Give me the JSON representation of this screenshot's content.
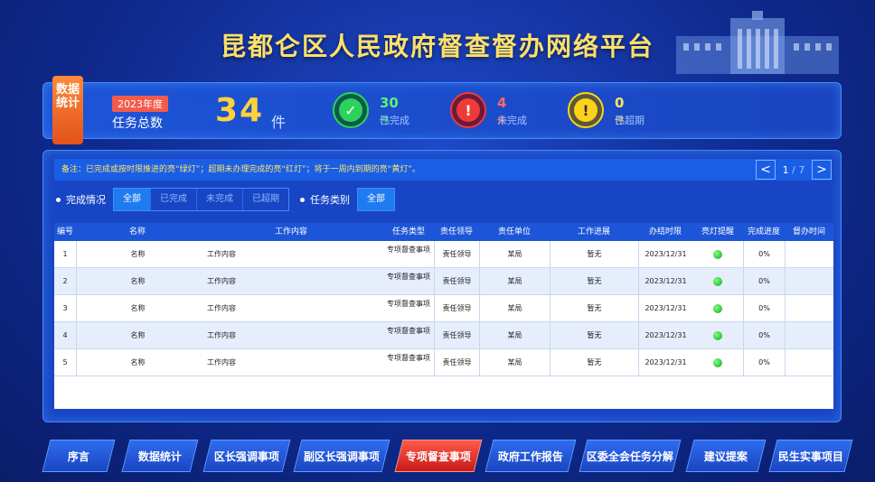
{
  "header": {
    "title": "昆都仑区人民政府督查督办网络平台"
  },
  "stats": {
    "tag": "数据统计",
    "year_badge": "2023年度",
    "total_label": "任务总数",
    "total_value": "34",
    "total_unit": "件",
    "items": [
      {
        "value": "30",
        "unit": "件",
        "label": "已完成",
        "icon": "check-icon",
        "color": "#2ad35a"
      },
      {
        "value": "4",
        "unit": "件",
        "label": "未完成",
        "icon": "exclamation-icon",
        "color": "#f03a3a"
      },
      {
        "value": "0",
        "unit": "件",
        "label": "已超期",
        "icon": "exclamation-icon",
        "color": "#ffd21a"
      }
    ]
  },
  "main": {
    "note": "备注：已完成或按时限推进的亮“绿灯”；超期未办理完成的亮“红灯”；将于一周内到期的亮“黄灯”。",
    "pager": {
      "prev": "<",
      "current": "1",
      "total": "/ 7",
      "next": ">"
    },
    "filters": {
      "status_label": "完成情况",
      "status_options": [
        "全部",
        "已完成",
        "未完成",
        "已超期"
      ],
      "type_label": "任务类别",
      "type_options": [
        "全部"
      ]
    },
    "columns": [
      "编号",
      "名称",
      "工作内容",
      "任务类型",
      "责任领导",
      "责任单位",
      "工作进展",
      "办结时限",
      "亮灯提醒",
      "完成进度",
      "督办时间"
    ],
    "rows": [
      {
        "no": "1",
        "name": "名称",
        "content": "工作内容",
        "type": "专项督查事项",
        "leader": "责任领导",
        "unit": "某局",
        "progress": "暂无",
        "deadline": "2023/12/31",
        "light": "green",
        "percent": "0%",
        "time": ""
      },
      {
        "no": "2",
        "name": "名称",
        "content": "工作内容",
        "type": "专项督查事项",
        "leader": "责任领导",
        "unit": "某局",
        "progress": "暂无",
        "deadline": "2023/12/31",
        "light": "green",
        "percent": "0%",
        "time": ""
      },
      {
        "no": "3",
        "name": "名称",
        "content": "工作内容",
        "type": "专项督查事项",
        "leader": "责任领导",
        "unit": "某局",
        "progress": "暂无",
        "deadline": "2023/12/31",
        "light": "green",
        "percent": "0%",
        "time": ""
      },
      {
        "no": "4",
        "name": "名称",
        "content": "工作内容",
        "type": "专项督查事项",
        "leader": "责任领导",
        "unit": "某局",
        "progress": "暂无",
        "deadline": "2023/12/31",
        "light": "green",
        "percent": "0%",
        "time": ""
      },
      {
        "no": "5",
        "name": "名称",
        "content": "工作内容",
        "type": "专项督查事项",
        "leader": "责任领导",
        "unit": "某局",
        "progress": "暂无",
        "deadline": "2023/12/31",
        "light": "green",
        "percent": "0%",
        "time": ""
      }
    ]
  },
  "nav": {
    "items": [
      "序言",
      "数据统计",
      "区长强调事项",
      "副区长强调事项",
      "专项督查事项",
      "政府工作报告",
      "区委全会任务分解",
      "建议提案",
      "民生实事项目"
    ],
    "active": "专项督查事项"
  }
}
